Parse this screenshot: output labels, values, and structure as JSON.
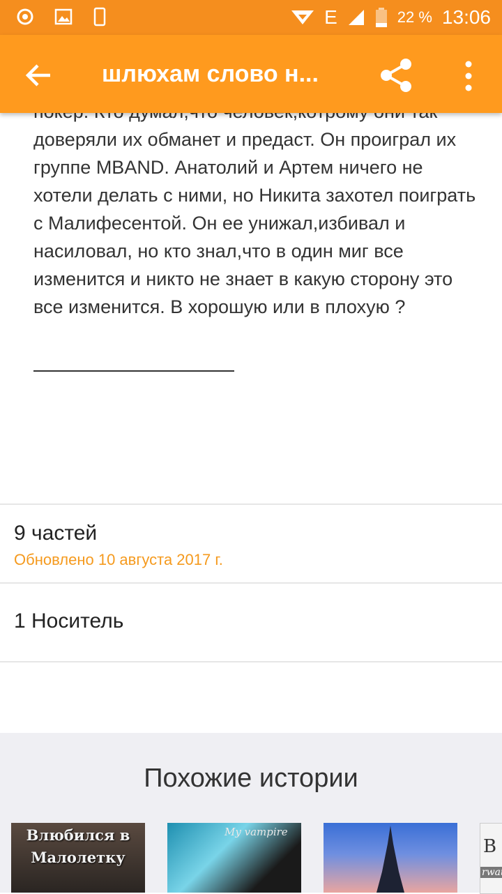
{
  "status_bar": {
    "battery_percent": "22 %",
    "time": "13:06",
    "network": "E"
  },
  "app_bar": {
    "title": "шлюхам слово н..."
  },
  "description": {
    "text": "покер. Кто думал,что человек,котрому они так доверяли их обманет и предаст. Он проиграл их группе MBAND. Анатолий и Артем ничего не хотели делать с ними, но Никита захотел поиграть с Малифесентой. Он ее унижал,избивал и насиловал, но кто знал,что в один миг все изменится и никто не знает в какую сторону это все изменится. В хорошую или в плохую ?"
  },
  "info": {
    "parts": "9 частей",
    "updated": "Обновлено 10 августа 2017 г.",
    "carrier": "1 Носитель"
  },
  "similar": {
    "title": "Похожие истории",
    "covers": [
      {
        "text": "Влюбился в Малолетку"
      },
      {
        "text": "My vampire"
      },
      {
        "text": ""
      },
      {
        "text": "rwate"
      }
    ]
  },
  "colors": {
    "status_bar": "#f58e1e",
    "app_bar": "#ff9a1e",
    "accent_text": "#f59a1e"
  }
}
